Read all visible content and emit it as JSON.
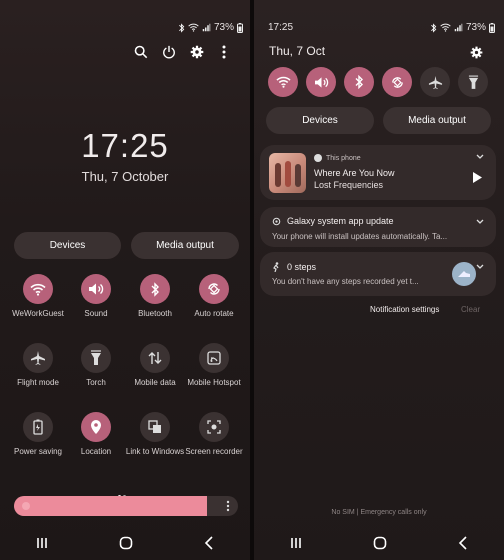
{
  "left": {
    "status": {
      "battery": "73%"
    },
    "clock": {
      "time": "17:25",
      "date": "Thu, 7 October"
    },
    "header_icons": [
      "search-icon",
      "power-icon",
      "gear-icon",
      "more-vertical-icon"
    ],
    "buttons": {
      "devices": "Devices",
      "media_output": "Media output"
    },
    "tiles": [
      {
        "label": "WeWorkGuest",
        "icon": "wifi-icon",
        "on": true
      },
      {
        "label": "Sound",
        "icon": "sound-icon",
        "on": true
      },
      {
        "label": "Bluetooth",
        "icon": "bluetooth-icon",
        "on": true
      },
      {
        "label": "Auto rotate",
        "icon": "auto-rotate-icon",
        "on": true
      },
      {
        "label": "Flight mode",
        "icon": "airplane-icon",
        "on": false
      },
      {
        "label": "Torch",
        "icon": "torch-icon",
        "on": false
      },
      {
        "label": "Mobile data",
        "icon": "mobile-data-icon",
        "on": false
      },
      {
        "label": "Mobile Hotspot",
        "icon": "hotspot-icon",
        "on": false
      },
      {
        "label": "Power saving",
        "icon": "battery-icon",
        "on": false
      },
      {
        "label": "Location",
        "icon": "location-icon",
        "on": true
      },
      {
        "label": "Link to Windows",
        "icon": "link-windows-icon",
        "on": false
      },
      {
        "label": "Screen recorder",
        "icon": "screen-recorder-icon",
        "on": false
      }
    ],
    "brightness": {
      "level": 0.86
    }
  },
  "right": {
    "status": {
      "time": "17:25",
      "battery": "73%"
    },
    "date": "Thu, 7 Oct",
    "quick_icons": [
      "wifi-icon",
      "sound-icon",
      "bluetooth-icon",
      "auto-rotate-icon",
      "airplane-icon",
      "torch-icon"
    ],
    "buttons": {
      "devices": "Devices",
      "media_output": "Media output"
    },
    "media": {
      "source": "This phone",
      "title": "Where Are You Now",
      "artist": "Lost Frequencies"
    },
    "notifications": [
      {
        "title": "Galaxy system app update",
        "body": "Your phone will install updates automatically. Ta..."
      },
      {
        "title": "0 steps",
        "body": "You don't have any steps recorded yet t..."
      }
    ],
    "actions": {
      "settings": "Notification settings",
      "clear": "Clear"
    },
    "carrier": "No SIM | Emergency calls only"
  },
  "colors": {
    "accent": "#b7617a",
    "tile_off": "#3b3232",
    "card": "#332a2a",
    "brightness": "#ec8b9b"
  }
}
